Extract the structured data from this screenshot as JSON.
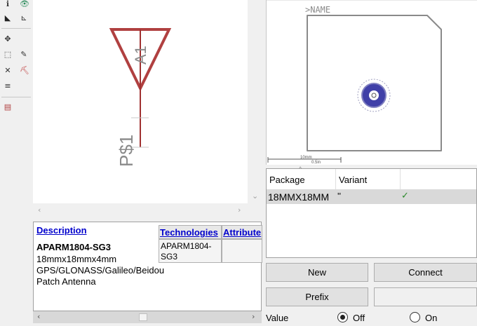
{
  "toolbar": {
    "icons": [
      "info-icon",
      "eye-icon",
      "fill-icon",
      "axis-icon",
      "move-icon",
      "select-rect-icon",
      "pen-icon",
      "delete-icon",
      "paint-icon",
      "align-icon",
      "paste-icon"
    ]
  },
  "schematic": {
    "pin_label": "P$1",
    "symbol_label": "A1",
    "symbol_color": "#b04040",
    "pin_color": "#a03030"
  },
  "description": {
    "link_label": "Description",
    "part_name": "APARM1804-SG3",
    "lines": [
      "18mmx18mmx4mm",
      "GPS/GLONASS/Galileo/Beidou",
      "Patch Antenna"
    ]
  },
  "technologies": {
    "headers": [
      "Technologies",
      "Attribute"
    ],
    "rows": [
      [
        "APARM1804-\nSG3",
        ""
      ]
    ]
  },
  "preview": {
    "name_label": ">NAME",
    "scale_mm": "10mm",
    "scale_in": "0.5in"
  },
  "package_table": {
    "headers": [
      "Package",
      "Variant"
    ],
    "rows": [
      {
        "package": "18MMX18MM",
        "variant": "''",
        "check": "✓"
      }
    ]
  },
  "buttons": {
    "new": "New",
    "connect": "Connect",
    "prefix": "Prefix"
  },
  "value": {
    "label": "Value",
    "off": "Off",
    "on": "On",
    "selected": "off"
  },
  "colors": {
    "link": "#0000cc",
    "check": "#2a8a2a",
    "pad": "#3a3aa0"
  }
}
